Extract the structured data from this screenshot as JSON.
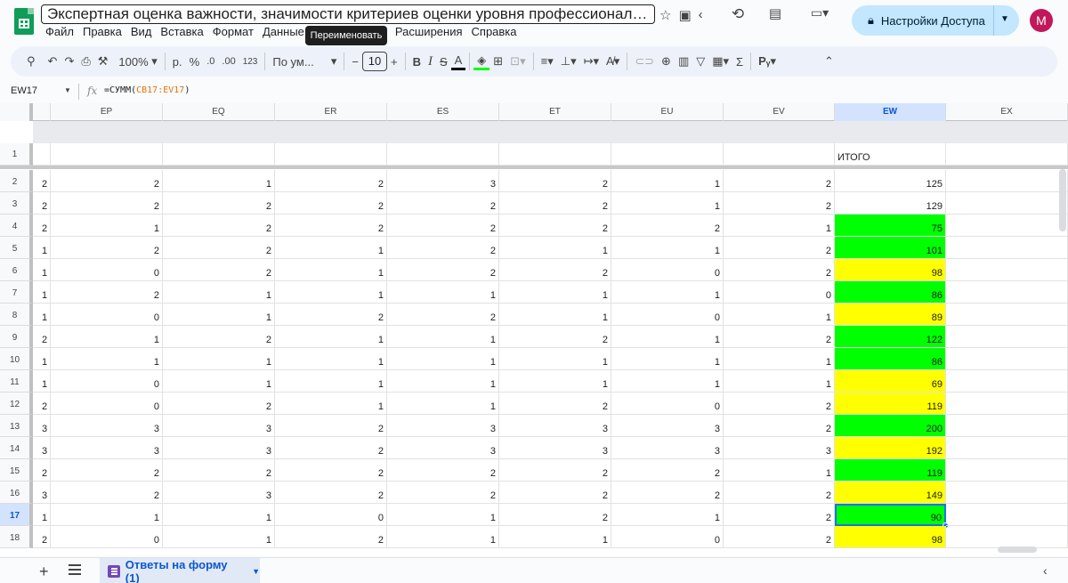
{
  "header": {
    "doc_title": "Экспертная оценка важности, значимости критериев оценки уровня профессионального мас...",
    "menu": [
      "Файл",
      "Правка",
      "Вид",
      "Вставка",
      "Формат",
      "Данные",
      "Расширения",
      "Справка"
    ],
    "tooltip": "Переименовать",
    "share_label": "Настройки Доступа",
    "avatar_letter": "M"
  },
  "toolbar": {
    "zoom": "100%",
    "currency": "р.",
    "percent": "%",
    "dec_minus": ".0",
    "dec_plus": ".00",
    "num_format": "123",
    "font_name": "По ум...",
    "font_size": "10"
  },
  "formula_bar": {
    "name_box": "EW17",
    "formula_prefix": "=СУММ(",
    "formula_ref": "CB17:EV17",
    "formula_suffix": ")"
  },
  "columns": [
    "EP",
    "EQ",
    "ER",
    "ES",
    "ET",
    "EU",
    "EV",
    "EW",
    "EX"
  ],
  "selected_column": "EW",
  "header_row": {
    "row": "1",
    "ew_label": "ИТОГО"
  },
  "rows": [
    {
      "n": "2",
      "eo": "2",
      "vals": [
        "2",
        "1",
        "2",
        "3",
        "2",
        "1",
        "2"
      ],
      "total": "125",
      "fill": "none"
    },
    {
      "n": "3",
      "eo": "2",
      "vals": [
        "2",
        "2",
        "2",
        "2",
        "2",
        "1",
        "2"
      ],
      "total": "129",
      "fill": "none"
    },
    {
      "n": "4",
      "eo": "2",
      "vals": [
        "1",
        "2",
        "2",
        "2",
        "2",
        "2",
        "1"
      ],
      "total": "75",
      "fill": "green"
    },
    {
      "n": "5",
      "eo": "1",
      "vals": [
        "2",
        "2",
        "1",
        "2",
        "1",
        "1",
        "2"
      ],
      "total": "101",
      "fill": "green"
    },
    {
      "n": "6",
      "eo": "1",
      "vals": [
        "0",
        "2",
        "1",
        "2",
        "2",
        "0",
        "2"
      ],
      "total": "98",
      "fill": "yellow"
    },
    {
      "n": "7",
      "eo": "1",
      "vals": [
        "2",
        "1",
        "1",
        "1",
        "1",
        "1",
        "0"
      ],
      "total": "86",
      "fill": "green"
    },
    {
      "n": "8",
      "eo": "1",
      "vals": [
        "0",
        "1",
        "2",
        "2",
        "1",
        "0",
        "1"
      ],
      "total": "89",
      "fill": "yellow"
    },
    {
      "n": "9",
      "eo": "2",
      "vals": [
        "1",
        "2",
        "1",
        "1",
        "2",
        "1",
        "2"
      ],
      "total": "122",
      "fill": "green"
    },
    {
      "n": "10",
      "eo": "1",
      "vals": [
        "1",
        "1",
        "1",
        "1",
        "1",
        "1",
        "1"
      ],
      "total": "86",
      "fill": "green"
    },
    {
      "n": "11",
      "eo": "1",
      "vals": [
        "0",
        "1",
        "1",
        "1",
        "1",
        "1",
        "1"
      ],
      "total": "69",
      "fill": "yellow"
    },
    {
      "n": "12",
      "eo": "2",
      "vals": [
        "0",
        "2",
        "1",
        "1",
        "2",
        "0",
        "2"
      ],
      "total": "119",
      "fill": "yellow"
    },
    {
      "n": "13",
      "eo": "3",
      "vals": [
        "3",
        "3",
        "2",
        "3",
        "3",
        "3",
        "2"
      ],
      "total": "200",
      "fill": "green"
    },
    {
      "n": "14",
      "eo": "3",
      "vals": [
        "3",
        "3",
        "2",
        "3",
        "3",
        "3",
        "3"
      ],
      "total": "192",
      "fill": "yellow"
    },
    {
      "n": "15",
      "eo": "2",
      "vals": [
        "2",
        "2",
        "2",
        "2",
        "2",
        "2",
        "1"
      ],
      "total": "119",
      "fill": "green"
    },
    {
      "n": "16",
      "eo": "3",
      "vals": [
        "2",
        "3",
        "2",
        "2",
        "2",
        "2",
        "2"
      ],
      "total": "149",
      "fill": "yellow"
    },
    {
      "n": "17",
      "eo": "1",
      "vals": [
        "1",
        "1",
        "0",
        "1",
        "2",
        "1",
        "2"
      ],
      "total": "90",
      "fill": "green",
      "active": true
    },
    {
      "n": "18",
      "eo": "2",
      "vals": [
        "0",
        "1",
        "2",
        "1",
        "1",
        "0",
        "2"
      ],
      "total": "98",
      "fill": "yellow"
    }
  ],
  "sheet_tab": "Ответы на форму (1)",
  "colors": {
    "green_fill": "#00ff00",
    "yellow_fill": "#ffff00",
    "accent": "#1a73e8",
    "share_bg": "#c2e7ff"
  }
}
